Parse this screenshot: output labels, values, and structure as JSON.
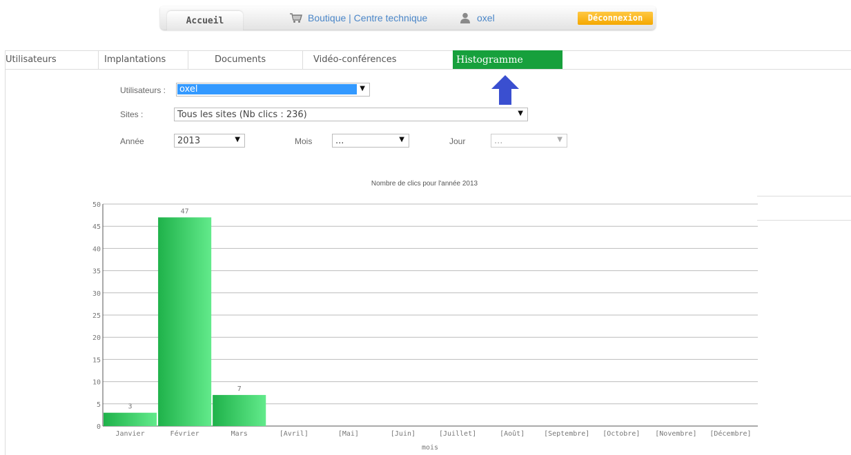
{
  "topbar": {
    "home_label": "Accueil",
    "shop_label": "Boutique | Centre technique",
    "user_label": "oxel",
    "logout_label": "Déconnexion"
  },
  "nav": {
    "tabs": [
      {
        "label": "Utilisateurs"
      },
      {
        "label": "Implantations"
      },
      {
        "label": "Documents"
      },
      {
        "label": "Vidéo-conférences"
      },
      {
        "label": "Histogramme",
        "active": true
      }
    ]
  },
  "filters": {
    "user_label": "Utilisateurs :",
    "user_value": "oxel",
    "sites_label": "Sites :",
    "sites_value": "Tous les sites (Nb clics : 236)",
    "year_label": "Année",
    "year_value": "2013",
    "month_label": "Mois",
    "month_value": "...",
    "day_label": "Jour",
    "day_value": "..."
  },
  "colors": {
    "active_tab": "#17a03c",
    "bar": "#3ed46b",
    "logout": "#f5a800",
    "link": "#4a86c8",
    "arrow": "#3a4fd0"
  },
  "icons": [
    "cart-icon",
    "user-icon",
    "arrow-up-icon",
    "dropdown-arrow-icon"
  ],
  "chart_data": {
    "type": "bar",
    "title": "Nombre de clics pour l'année 2013",
    "xlabel": "mois",
    "ylabel": "",
    "ylim": [
      0,
      50
    ],
    "yticks": [
      0,
      5,
      10,
      15,
      20,
      25,
      30,
      35,
      40,
      45,
      50
    ],
    "categories": [
      "Janvier",
      "Février",
      "Mars",
      "[Avril]",
      "[Mai]",
      "[Juin]",
      "[Juillet]",
      "[Août]",
      "[Septembre]",
      "[Octobre]",
      "[Novembre]",
      "[Décembre]"
    ],
    "values": [
      3,
      47,
      7,
      0,
      0,
      0,
      0,
      0,
      0,
      0,
      0,
      0
    ],
    "data_labels": [
      "3",
      "47",
      "7",
      "",
      "",
      "",
      "",
      "",
      "",
      "",
      "",
      ""
    ],
    "grid": true
  }
}
